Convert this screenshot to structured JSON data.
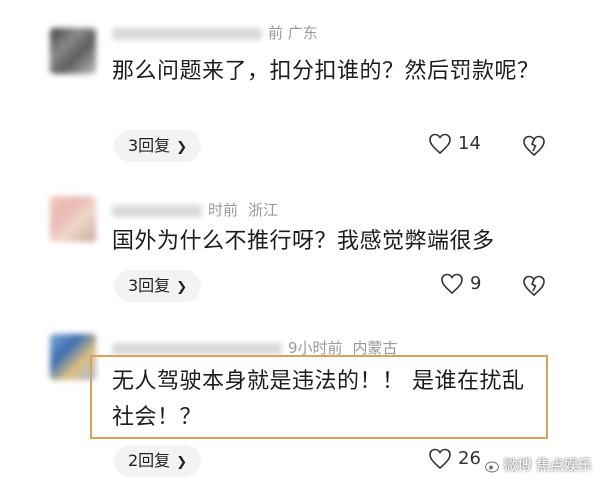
{
  "comments": [
    {
      "meta_location": "前 广东",
      "text": "那么问题来了，扣分扣谁的？然后罚款呢？",
      "replies_label": "3回复",
      "likes": "14"
    },
    {
      "meta_time": "时前",
      "meta_location": "浙江",
      "text": "国外为什么不推行呀？我感觉弊端很多",
      "replies_label": "3回复",
      "likes": "9"
    },
    {
      "meta_time": "9小时前",
      "meta_location": "内蒙古",
      "text": "无人驾驶本身就是违法的！！ 是谁在扰乱社会！？",
      "replies_label": "2回复",
      "likes": "26"
    }
  ],
  "icons": {
    "like": "heart-icon",
    "dislike": "broken-heart-icon",
    "chevron": "chevron-right-icon"
  },
  "highlight_color": "#d9a15c",
  "watermark": "微博 焦点娱乐"
}
